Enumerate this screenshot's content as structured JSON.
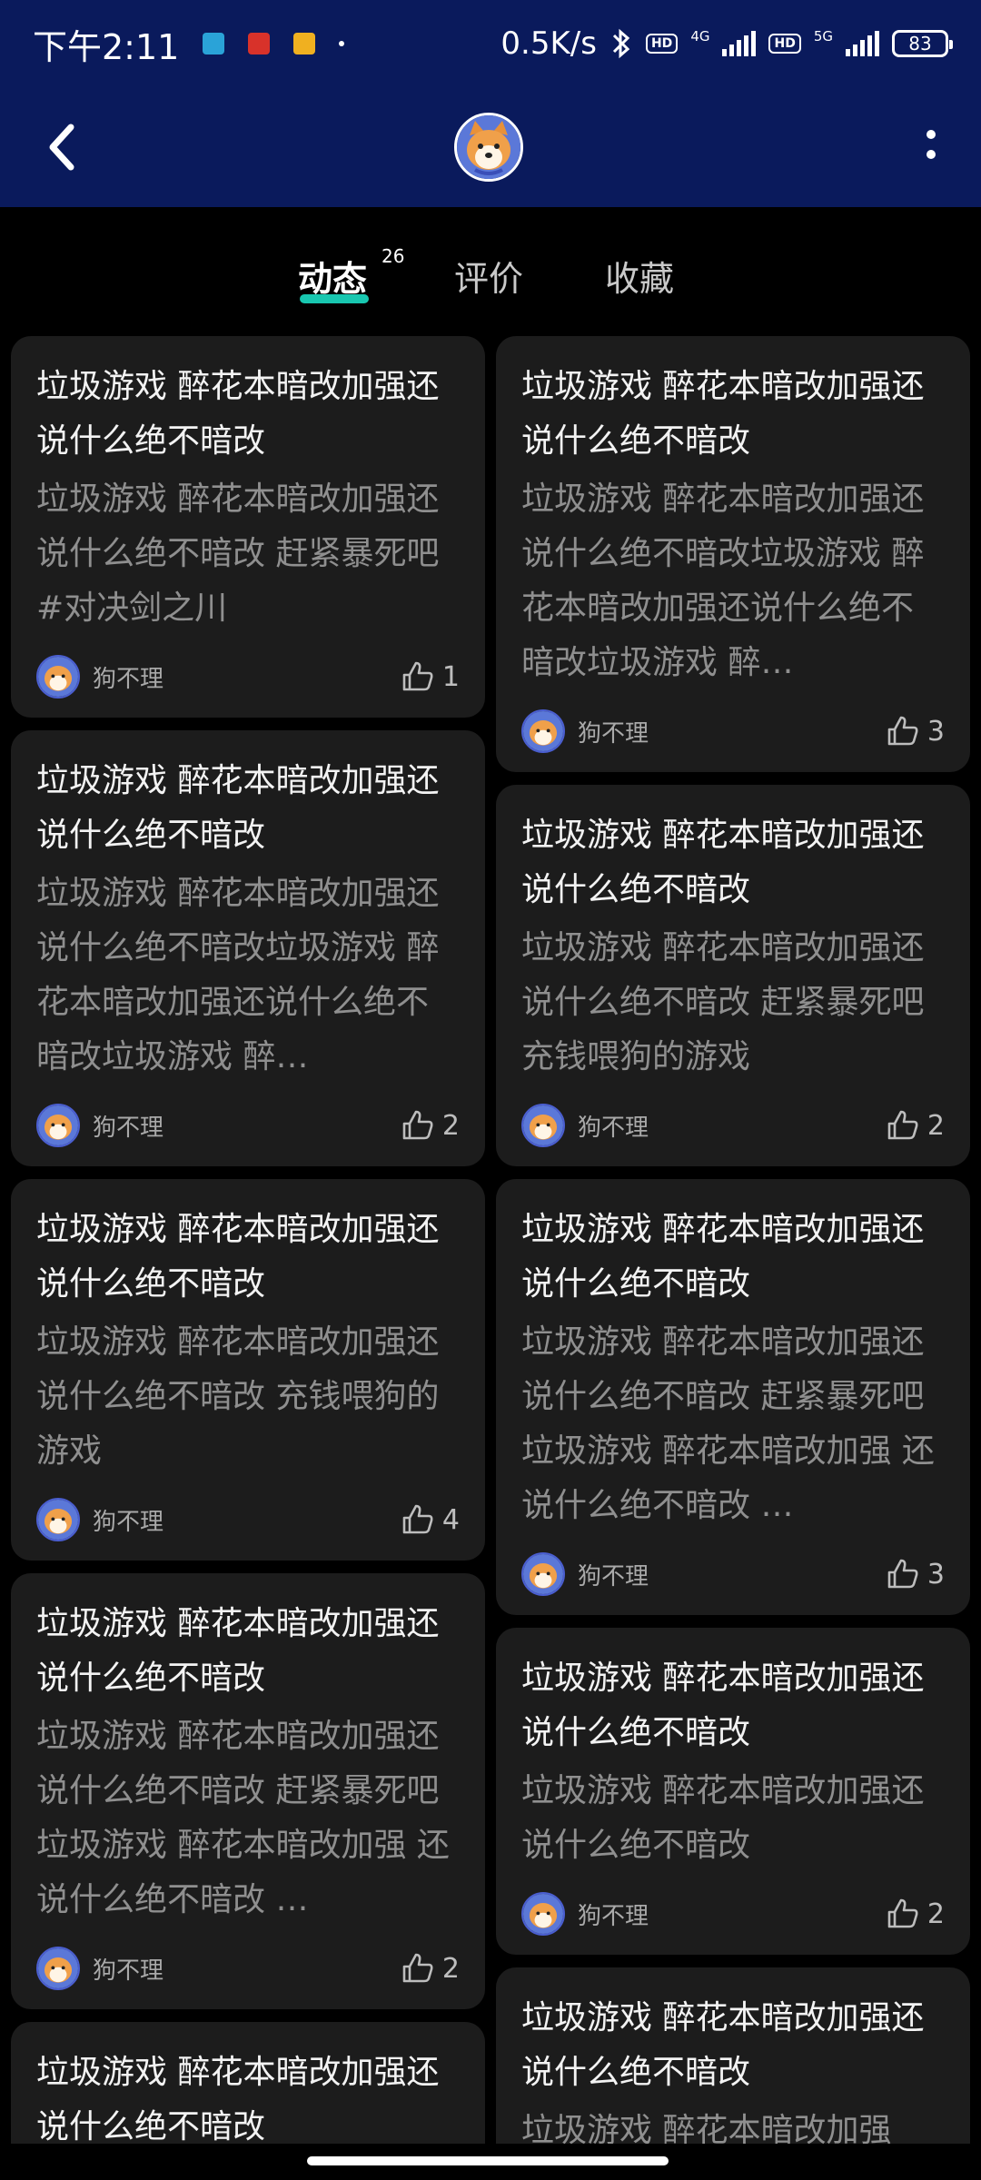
{
  "status_bar": {
    "time": "下午2:11",
    "net_speed": "0.5K/s",
    "sim1_tag": "4G",
    "sim2_tag": "5G",
    "hd_label": "HD",
    "battery": "83"
  },
  "tabs": [
    {
      "label": "动态",
      "active": true
    },
    {
      "label": "评价",
      "active": false
    },
    {
      "label": "收藏",
      "active": false
    }
  ],
  "tab_count": "26",
  "colors": {
    "header_bg": "#0a1a5c",
    "accent": "#18c7b0",
    "card_bg": "#1c1c1c"
  },
  "posts": {
    "left": [
      {
        "title": "垃圾游戏 醉花本暗改加强还说什么绝不暗改",
        "body": "垃圾游戏 醉花本暗改加强还说什么绝不暗改 赶紧暴死吧 #对决剑之川",
        "author": "狗不理",
        "likes": "1"
      },
      {
        "title": "垃圾游戏 醉花本暗改加强还说什么绝不暗改",
        "body": "垃圾游戏 醉花本暗改加强还说什么绝不暗改垃圾游戏 醉花本暗改加强还说什么绝不暗改垃圾游戏 醉…",
        "author": "狗不理",
        "likes": "2"
      },
      {
        "title": "垃圾游戏 醉花本暗改加强还说什么绝不暗改",
        "body": "垃圾游戏 醉花本暗改加强还说什么绝不暗改 充钱喂狗的游戏",
        "author": "狗不理",
        "likes": "4"
      },
      {
        "title": "垃圾游戏 醉花本暗改加强还说什么绝不暗改",
        "body": "垃圾游戏 醉花本暗改加强还说什么绝不暗改 赶紧暴死吧垃圾游戏 醉花本暗改加强 还说什么绝不暗改 …",
        "author": "狗不理",
        "likes": "2"
      },
      {
        "title": "垃圾游戏 醉花本暗改加强还说什么绝不暗改",
        "body": "",
        "author": "",
        "likes": ""
      }
    ],
    "right": [
      {
        "title": "垃圾游戏 醉花本暗改加强还说什么绝不暗改",
        "body": "垃圾游戏 醉花本暗改加强还说什么绝不暗改垃圾游戏 醉花本暗改加强还说什么绝不暗改垃圾游戏 醉…",
        "author": "狗不理",
        "likes": "3"
      },
      {
        "title": "垃圾游戏 醉花本暗改加强还说什么绝不暗改",
        "body": "垃圾游戏 醉花本暗改加强还说什么绝不暗改 赶紧暴死吧充钱喂狗的游戏",
        "author": "狗不理",
        "likes": "2"
      },
      {
        "title": "垃圾游戏 醉花本暗改加强还说什么绝不暗改",
        "body": "垃圾游戏 醉花本暗改加强还说什么绝不暗改 赶紧暴死吧垃圾游戏 醉花本暗改加强 还说什么绝不暗改 …",
        "author": "狗不理",
        "likes": "3"
      },
      {
        "title": "垃圾游戏 醉花本暗改加强还说什么绝不暗改",
        "body": "垃圾游戏 醉花本暗改加强还说什么绝不暗改",
        "author": "狗不理",
        "likes": "2"
      },
      {
        "title": "垃圾游戏 醉花本暗改加强还说什么绝不暗改",
        "body": "垃圾游戏 醉花本暗改加强",
        "author": "",
        "likes": ""
      }
    ]
  }
}
